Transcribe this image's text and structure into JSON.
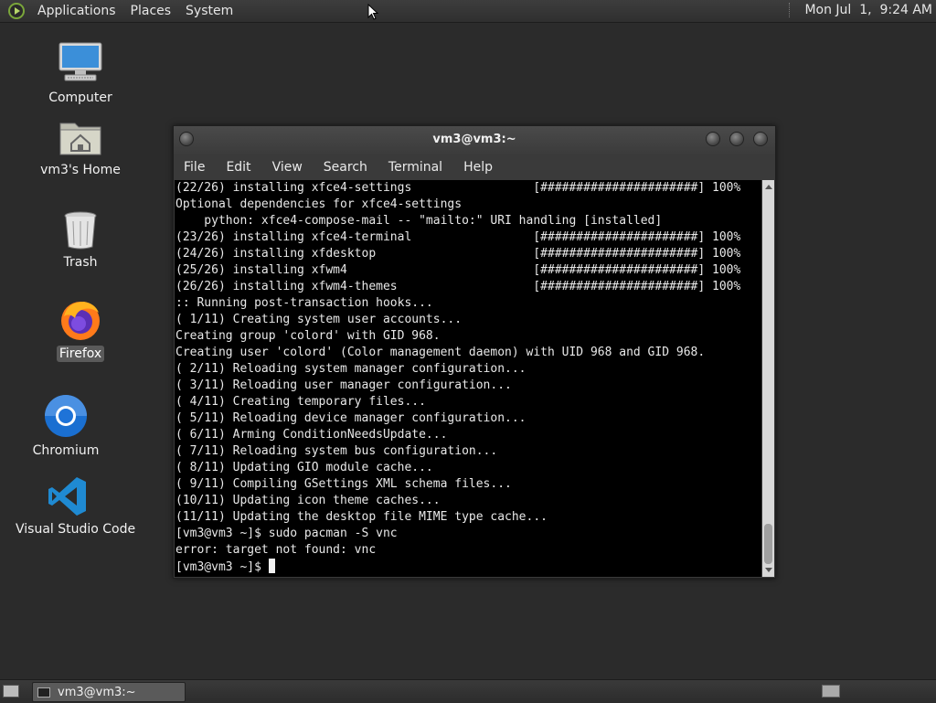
{
  "top_panel": {
    "menus": [
      "Applications",
      "Places",
      "System"
    ],
    "clock": "Mon Jul  1,  9:24 AM"
  },
  "desktop": {
    "icons": [
      {
        "label": "Computer",
        "icon": "computer-icon"
      },
      {
        "label": "vm3's Home",
        "icon": "home-folder-icon"
      },
      {
        "label": "Trash",
        "icon": "trash-icon"
      },
      {
        "label": "Firefox",
        "icon": "firefox-icon",
        "selected": true
      },
      {
        "label": "Chromium",
        "icon": "chromium-icon"
      },
      {
        "label": "Visual Studio Code",
        "icon": "vscode-icon"
      }
    ]
  },
  "terminal": {
    "title": "vm3@vm3:~",
    "menus": [
      "File",
      "Edit",
      "View",
      "Search",
      "Terminal",
      "Help"
    ],
    "lines": [
      "(22/26) installing xfce4-settings                 [######################] 100%",
      "Optional dependencies for xfce4-settings",
      "    python: xfce4-compose-mail -- \"mailto:\" URI handling [installed]",
      "(23/26) installing xfce4-terminal                 [######################] 100%",
      "(24/26) installing xfdesktop                      [######################] 100%",
      "(25/26) installing xfwm4                          [######################] 100%",
      "(26/26) installing xfwm4-themes                   [######################] 100%",
      ":: Running post-transaction hooks...",
      "( 1/11) Creating system user accounts...",
      "Creating group 'colord' with GID 968.",
      "Creating user 'colord' (Color management daemon) with UID 968 and GID 968.",
      "( 2/11) Reloading system manager configuration...",
      "( 3/11) Reloading user manager configuration...",
      "( 4/11) Creating temporary files...",
      "( 5/11) Reloading device manager configuration...",
      "( 6/11) Arming ConditionNeedsUpdate...",
      "( 7/11) Reloading system bus configuration...",
      "( 8/11) Updating GIO module cache...",
      "( 9/11) Compiling GSettings XML schema files...",
      "(10/11) Updating icon theme caches...",
      "(11/11) Updating the desktop file MIME type cache...",
      "[vm3@vm3 ~]$ sudo pacman -S vnc",
      "error: target not found: vnc"
    ],
    "prompt": "[vm3@vm3 ~]$ "
  },
  "taskbar": {
    "window_button": "vm3@vm3:~"
  }
}
